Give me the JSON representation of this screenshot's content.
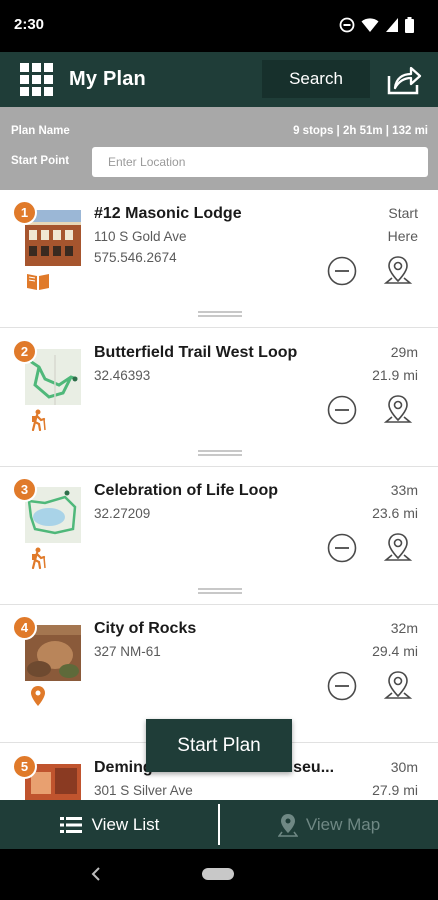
{
  "status_bar": {
    "time": "2:30"
  },
  "header": {
    "title": "My Plan",
    "search_label": "Search"
  },
  "plan": {
    "name_label": "Plan Name",
    "summary": "9 stops | 2h 51m | 132 mi",
    "start_label": "Start Point",
    "location_placeholder": "Enter Location"
  },
  "stops": [
    {
      "number": "1",
      "title": "#12 Masonic Lodge",
      "line1": "110 S Gold Ave",
      "line2": "575.546.2674",
      "time": "Start",
      "distance": "Here",
      "type_icon": "book-icon"
    },
    {
      "number": "2",
      "title": "Butterfield Trail West Loop",
      "line1": "32.46393",
      "line2": "",
      "time": "29m",
      "distance": "21.9 mi",
      "type_icon": "hiker-icon"
    },
    {
      "number": "3",
      "title": "Celebration of Life Loop",
      "line1": "32.27209",
      "line2": "",
      "time": "33m",
      "distance": "23.6 mi",
      "type_icon": "hiker-icon"
    },
    {
      "number": "4",
      "title": "City of Rocks",
      "line1": "327 NM-61",
      "line2": "",
      "time": "32m",
      "distance": "29.4 mi",
      "type_icon": "location-pin-icon"
    },
    {
      "number": "5",
      "title": "Deming Luna Mimbres Museu...",
      "line1": "301 S Silver Ave",
      "line2": "",
      "time": "30m",
      "distance": "27.9 mi",
      "type_icon": "building-icon"
    }
  ],
  "actions": {
    "start_plan": "Start Plan"
  },
  "bottom_nav": {
    "view_list": "View List",
    "view_map": "View Map"
  },
  "colors": {
    "primary": "#1f3d38",
    "accent": "#e07a2a",
    "panel": "#a8a8a8"
  }
}
